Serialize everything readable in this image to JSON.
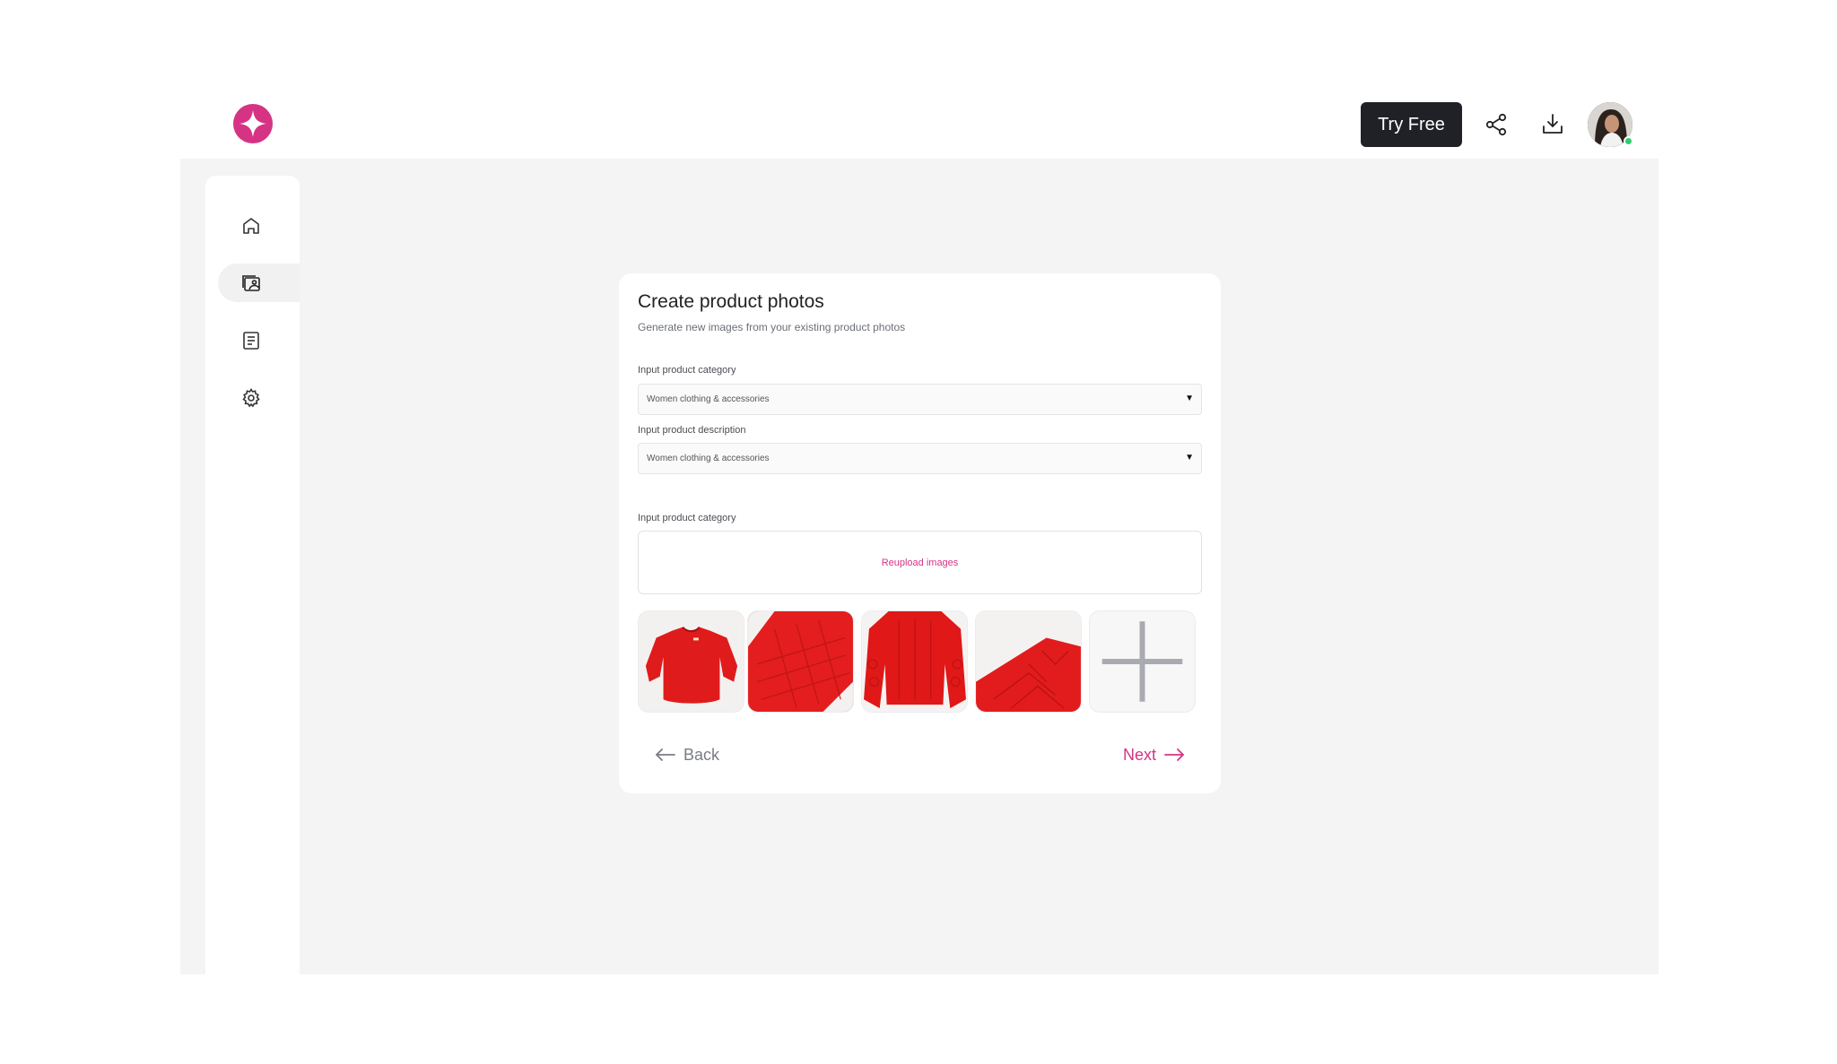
{
  "header": {
    "logo_icon": "sparkle-logo-icon",
    "try_free_label": "Try Free",
    "share_icon": "share-icon",
    "download_icon": "download-icon",
    "avatar": "user-avatar",
    "online_status_color": "#2ecc71"
  },
  "sidebar": {
    "items": [
      {
        "icon": "home-icon",
        "active": false
      },
      {
        "icon": "photo-gallery-icon",
        "active": true
      },
      {
        "icon": "document-icon",
        "active": false
      },
      {
        "icon": "settings-icon",
        "active": false
      }
    ]
  },
  "card": {
    "title": "Create product photos",
    "subtitle": "Generate new images from your existing product photos",
    "category": {
      "label": "Input product category",
      "value": "Women clothing & accessories"
    },
    "description": {
      "label": "Input product description",
      "value": "Women clothing & accessories"
    },
    "upload": {
      "label": "Input product category",
      "button_label": "Reupload images"
    },
    "thumbnails": [
      {
        "name": "red-sweater-front"
      },
      {
        "name": "red-knit-closeup"
      },
      {
        "name": "red-sweater-worn"
      },
      {
        "name": "red-knit-detail"
      }
    ],
    "add_image_icon": "plus-icon",
    "back_label": "Back",
    "next_label": "Next"
  },
  "colors": {
    "accent": "#d63384",
    "dark_button": "#1f2126",
    "workspace_bg": "#f4f4f5"
  }
}
